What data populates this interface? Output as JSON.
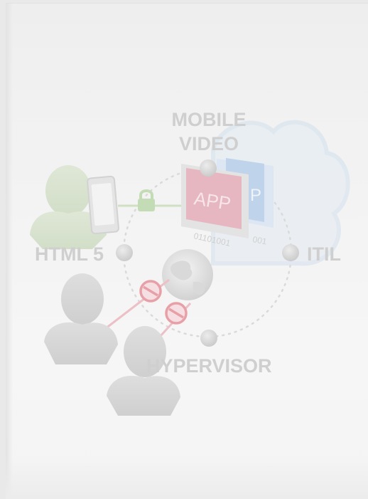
{
  "labels": {
    "top_line1": "MOBILE",
    "top_line2": "VIDEO",
    "left": "HTML 5",
    "right": "ITIL",
    "bottom": "HYPERVISOR"
  },
  "app_tiles": {
    "front": "APP",
    "back": "P",
    "binary_front": "01101001",
    "binary_back": "001"
  },
  "icons": [
    "user-icon",
    "smartphone-icon",
    "lock-icon",
    "globe-icon",
    "no-entry-icon",
    "cloud-icon",
    "app-box-icon"
  ],
  "colors": {
    "background": "#f3f3f3",
    "label": "#cfcfcf",
    "node": "#d8d8d8",
    "app_red": "#e9b4bd",
    "app_blue": "#b9cfe8",
    "no_entry_red": "#e8a0a8",
    "lock_green": "#c4dcb6",
    "cloud_blue": "#dce6f0"
  }
}
